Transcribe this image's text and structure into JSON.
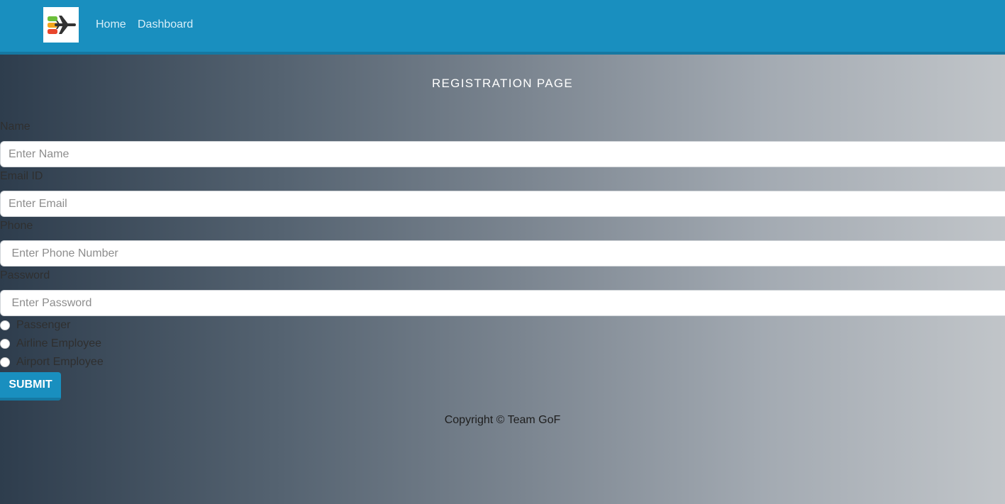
{
  "nav": {
    "links": [
      "Home",
      "Dashboard"
    ]
  },
  "page": {
    "title": "REGISTRATION PAGE"
  },
  "form": {
    "fields": [
      {
        "label": "Name",
        "placeholder": "Enter Name",
        "value": ""
      },
      {
        "label": "Email ID",
        "placeholder": "Enter Email",
        "value": ""
      },
      {
        "label": "Phone",
        "placeholder": " Enter Phone Number",
        "value": ""
      },
      {
        "label": "Password",
        "placeholder": " Enter Password",
        "value": ""
      }
    ],
    "roles": [
      "Passenger",
      "Airline Employee",
      "Airport Employee"
    ],
    "submit_label": "SUBMIT"
  },
  "footer": {
    "copyright": "Copyright © Team GoF"
  },
  "colors": {
    "brand": "#198fbf",
    "brand_dark": "#1578a2",
    "logo_green": "#6cbf3a",
    "logo_orange": "#f4a51c",
    "logo_red": "#e8452c",
    "logo_plane": "#333333"
  },
  "icons": {
    "logo": "airplane-logo-icon"
  }
}
